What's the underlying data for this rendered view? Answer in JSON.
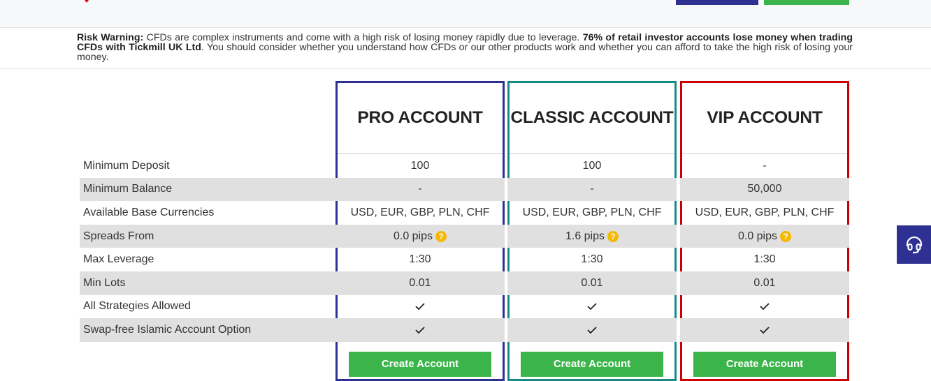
{
  "header": {
    "login_label": "",
    "signup_label": "",
    "colors": {
      "brand_blue": "#2e3192",
      "brand_green": "#3bb54a",
      "brand_red": "#d50000"
    }
  },
  "risk_warning": {
    "title": "Risk Warning:",
    "text_1": " CFDs are complex instruments and come with a high risk of losing money rapidly due to leverage. ",
    "bold_2": "76% of retail investor accounts lose money when trading CFDs with Tickmill UK Ltd",
    "text_3": ". You should consider whether you understand how CFDs or our other products work and whether you can afford to take the high risk of losing your money."
  },
  "features": [
    "Minimum Deposit",
    "Minimum Balance",
    "Available Base Currencies",
    "Spreads From",
    "Max Leverage",
    "Min Lots",
    "All Strategies Allowed",
    "Swap-free Islamic Account Option"
  ],
  "accounts": [
    {
      "name": "PRO ACCOUNT",
      "border_color": "#2e3192",
      "minimum_deposit": "100",
      "minimum_balance": "-",
      "base_currencies": "USD, EUR, GBP, PLN, CHF",
      "spreads_from": "0.0 pips",
      "max_leverage": "1:30",
      "min_lots": "0.01",
      "all_strategies_allowed": true,
      "swap_free_islamic": true,
      "button_label": "Create Account"
    },
    {
      "name": "CLASSIC ACCOUNT",
      "border_color": "#1a8a86",
      "minimum_deposit": "100",
      "minimum_balance": "-",
      "base_currencies": "USD, EUR, GBP, PLN, CHF",
      "spreads_from": "1.6 pips",
      "max_leverage": "1:30",
      "min_lots": "0.01",
      "all_strategies_allowed": true,
      "swap_free_islamic": true,
      "button_label": "Create Account"
    },
    {
      "name": "VIP ACCOUNT",
      "border_color": "#cc0000",
      "minimum_deposit": "-",
      "minimum_balance": "50,000",
      "base_currencies": "USD, EUR, GBP, PLN, CHF",
      "spreads_from": "0.0 pips",
      "max_leverage": "1:30",
      "min_lots": "0.01",
      "all_strategies_allowed": true,
      "swap_free_islamic": true,
      "button_label": "Create Account"
    }
  ],
  "help_icon_glyph": "?",
  "support_widget": {
    "icon": "headset-icon"
  }
}
